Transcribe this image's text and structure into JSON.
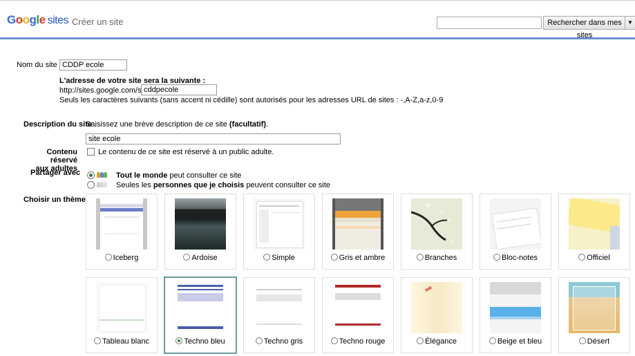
{
  "header": {
    "logo": "Google sites",
    "page_title": "Créer un site",
    "search_button": "Rechercher dans mes sites",
    "search_value": ""
  },
  "form": {
    "site_name_label": "Nom du site",
    "site_name_value": "CDDP ecole",
    "url_heading": "L'adresse de votre site sera la suivante :",
    "url_prefix": "http://sites.google.com/site/",
    "url_value": "cddpecole",
    "url_note": "Seuls les caractères suivants (sans accent ni cédille) sont autorisés pour les adresses URL de sites : -,A-Z,a-z,0-9",
    "desc_label": "Description du site",
    "desc_hint": "Saisissez une brève description de ce site",
    "desc_hint_bold": "(facultatif)",
    "desc_value": "site ecole",
    "adult_label_1": "Contenu réservé",
    "adult_label_2": "aux adultes",
    "adult_text": "Le contenu de ce site est réservé à un public adulte.",
    "share_label": "Partager avec",
    "share_opt1_bold": "Tout le monde",
    "share_opt1_rest": "peut consulter ce site",
    "share_opt2_pre": "Seules les",
    "share_opt2_bold": "personnes que je choisis",
    "share_opt2_rest": "peuvent consulter ce site",
    "theme_label": "Choisir un thème"
  },
  "themes": [
    {
      "name": "Iceberg",
      "selected": false
    },
    {
      "name": "Ardoise",
      "selected": false
    },
    {
      "name": "Simple",
      "selected": false
    },
    {
      "name": "Gris et ambre",
      "selected": false
    },
    {
      "name": "Branches",
      "selected": false
    },
    {
      "name": "Bloc-notes",
      "selected": false
    },
    {
      "name": "Officiel",
      "selected": false
    },
    {
      "name": "Tableau blanc",
      "selected": false
    },
    {
      "name": "Techno bleu",
      "selected": true
    },
    {
      "name": "Techno gris",
      "selected": false
    },
    {
      "name": "Techno rouge",
      "selected": false
    },
    {
      "name": "Élégance",
      "selected": false
    },
    {
      "name": "Beige et bleu",
      "selected": false
    },
    {
      "name": "Désert",
      "selected": false
    }
  ]
}
